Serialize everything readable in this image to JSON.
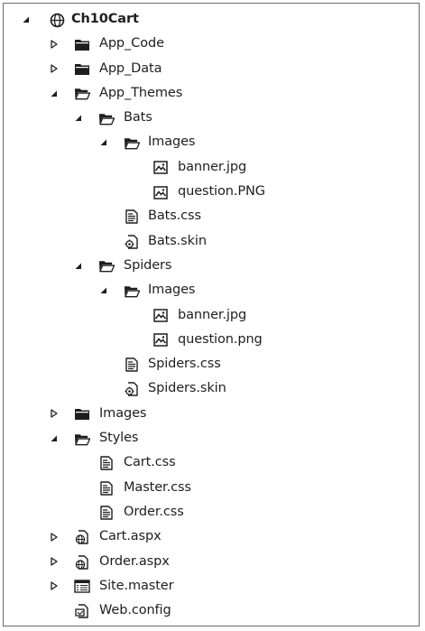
{
  "tree": [
    {
      "label": "Ch10Cart",
      "icon": "globe",
      "level": 0,
      "state": "expanded",
      "bold": true
    },
    {
      "label": "App_Code",
      "icon": "folder-closed",
      "level": 1,
      "state": "collapsed"
    },
    {
      "label": "App_Data",
      "icon": "folder-closed",
      "level": 1,
      "state": "collapsed"
    },
    {
      "label": "App_Themes",
      "icon": "folder-open",
      "level": 1,
      "state": "expanded"
    },
    {
      "label": "Bats",
      "icon": "folder-open",
      "level": 2,
      "state": "expanded"
    },
    {
      "label": "Images",
      "icon": "folder-open",
      "level": 3,
      "state": "expanded"
    },
    {
      "label": "banner.jpg",
      "icon": "image-file",
      "level": 4,
      "state": "leaf"
    },
    {
      "label": "question.PNG",
      "icon": "image-file",
      "level": 4,
      "state": "leaf"
    },
    {
      "label": "Bats.css",
      "icon": "css-file",
      "level": 3,
      "state": "leaf"
    },
    {
      "label": "Bats.skin",
      "icon": "skin-file",
      "level": 3,
      "state": "leaf"
    },
    {
      "label": "Spiders",
      "icon": "folder-open",
      "level": 2,
      "state": "expanded"
    },
    {
      "label": "Images",
      "icon": "folder-open",
      "level": 3,
      "state": "expanded"
    },
    {
      "label": "banner.jpg",
      "icon": "image-file",
      "level": 4,
      "state": "leaf"
    },
    {
      "label": "question.png",
      "icon": "image-file",
      "level": 4,
      "state": "leaf"
    },
    {
      "label": "Spiders.css",
      "icon": "css-file",
      "level": 3,
      "state": "leaf"
    },
    {
      "label": "Spiders.skin",
      "icon": "skin-file",
      "level": 3,
      "state": "leaf"
    },
    {
      "label": "Images",
      "icon": "folder-closed",
      "level": 1,
      "state": "collapsed"
    },
    {
      "label": "Styles",
      "icon": "folder-open",
      "level": 1,
      "state": "expanded"
    },
    {
      "label": "Cart.css",
      "icon": "css-file",
      "level": 2,
      "state": "leaf"
    },
    {
      "label": "Master.css",
      "icon": "css-file",
      "level": 2,
      "state": "leaf"
    },
    {
      "label": "Order.css",
      "icon": "css-file",
      "level": 2,
      "state": "leaf"
    },
    {
      "label": "Cart.aspx",
      "icon": "aspx-file",
      "level": 1,
      "state": "collapsed"
    },
    {
      "label": "Order.aspx",
      "icon": "aspx-file",
      "level": 1,
      "state": "collapsed"
    },
    {
      "label": "Site.master",
      "icon": "master-file",
      "level": 1,
      "state": "collapsed"
    },
    {
      "label": "Web.config",
      "icon": "config-file",
      "level": 1,
      "state": "leaf"
    }
  ],
  "colors": {
    "text": "#1e1e1e",
    "icon": "#1e1e1e",
    "border": "#6a6a6a",
    "background": "#ffffff"
  }
}
